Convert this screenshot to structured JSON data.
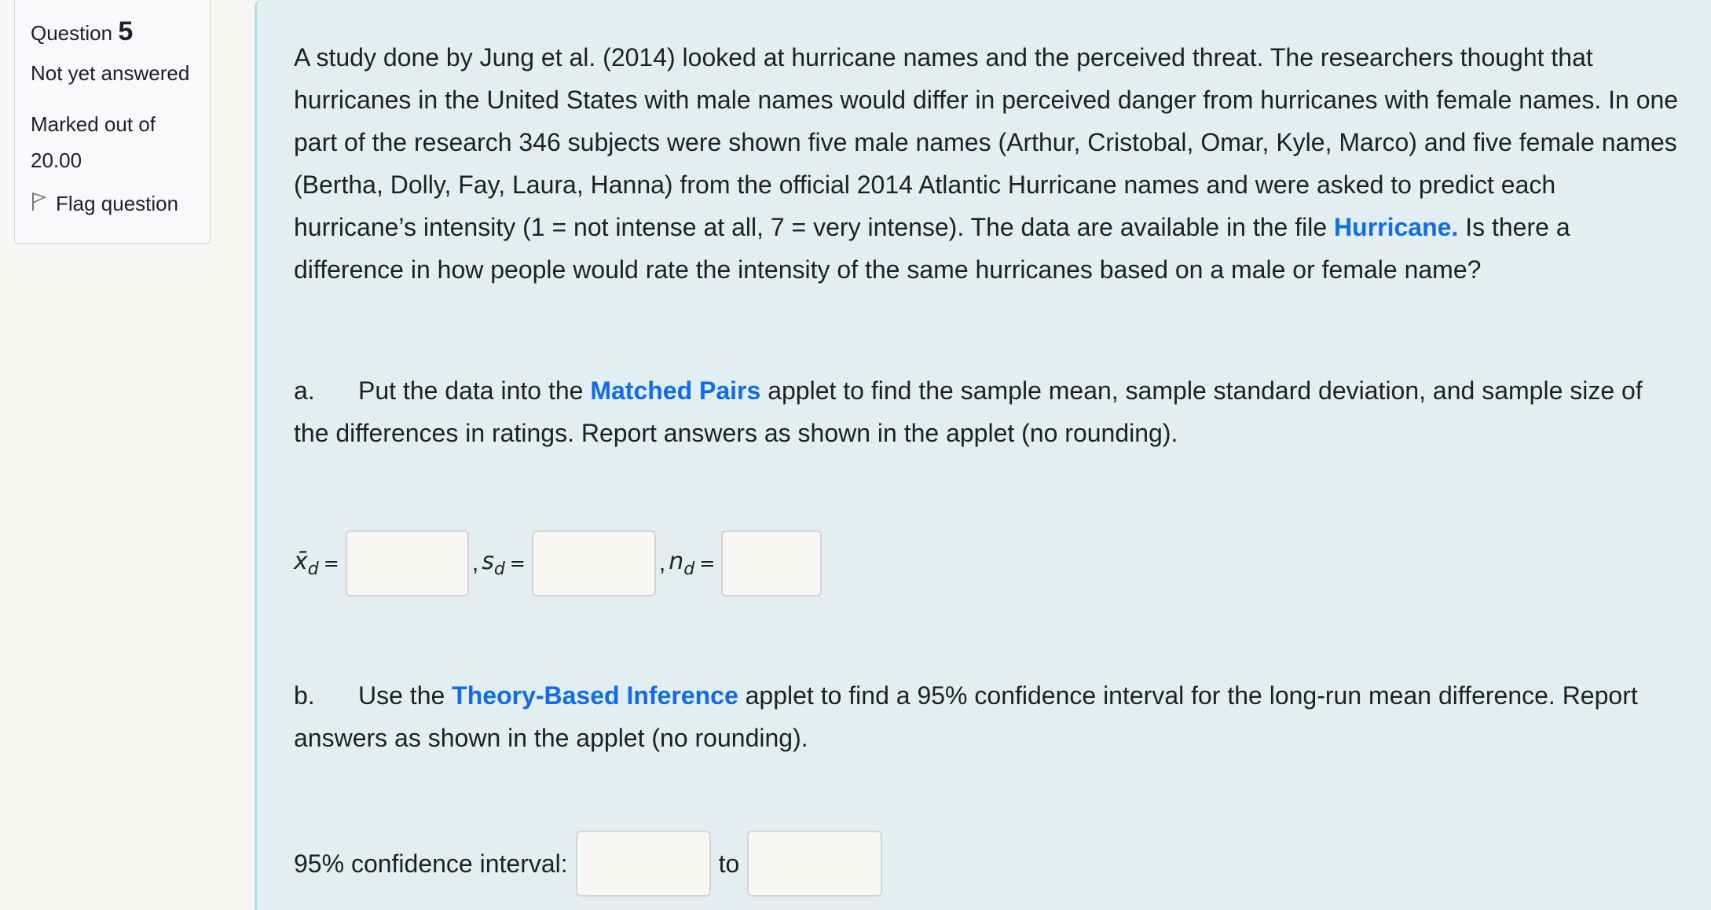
{
  "question_info": {
    "label": "Question",
    "number": "5",
    "state": "Not yet answered",
    "grade_label": "Marked out of",
    "grade_value": "20.00",
    "flag_label": "Flag question"
  },
  "question": {
    "intro_1": " A study done by Jung et al. (2014) looked at hurricane names and the perceived threat. The researchers thought that hurricanes in the United States with male names would differ in perceived danger from hurricanes with female names. In one part of the research 346 subjects were shown five male names (Arthur, Cristobal, Omar, Kyle, Marco) and five female names (Bertha, Dolly, Fay, Laura, Hanna) from the official 2014 Atlantic Hurricane names and were asked to predict each hurricane’s intensity (1 = not intense at all, 7 = very intense). The data are available in the file ",
    "intro_link": "Hurricane.",
    "intro_2": " Is there a difference in how people would rate the intensity of the same hurricanes based on a male or female name?",
    "part_a": {
      "label": "a.",
      "text_1": "Put the data into the ",
      "link": "Matched Pairs",
      "text_2": " applet to find the sample mean, sample standard deviation, and sample size of the differences in ratings. Report answers as shown in the applet (no rounding).",
      "fields": [
        {
          "symbol": "x̄",
          "sub": "d",
          "eq": "=",
          "value": ""
        },
        {
          "symbol": "s",
          "sub": "d",
          "eq": "=",
          "value": ""
        },
        {
          "symbol": "n",
          "sub": "d",
          "eq": "=",
          "value": ""
        }
      ],
      "separator": ","
    },
    "part_b": {
      "label": "b.",
      "text_1": "Use the ",
      "link": "Theory-Based Inference",
      "text_2": " applet to find a 95% confidence interval for the long-run mean difference. Report answers as shown in the applet (no rounding).",
      "ci_label": "95% confidence interval:",
      "ci_to": "to",
      "lower_value": "",
      "upper_value": ""
    }
  },
  "colors": {
    "link": "#0f6cf0",
    "content_bg": "#e2eeef",
    "page_bg": "#f8f7f4"
  }
}
